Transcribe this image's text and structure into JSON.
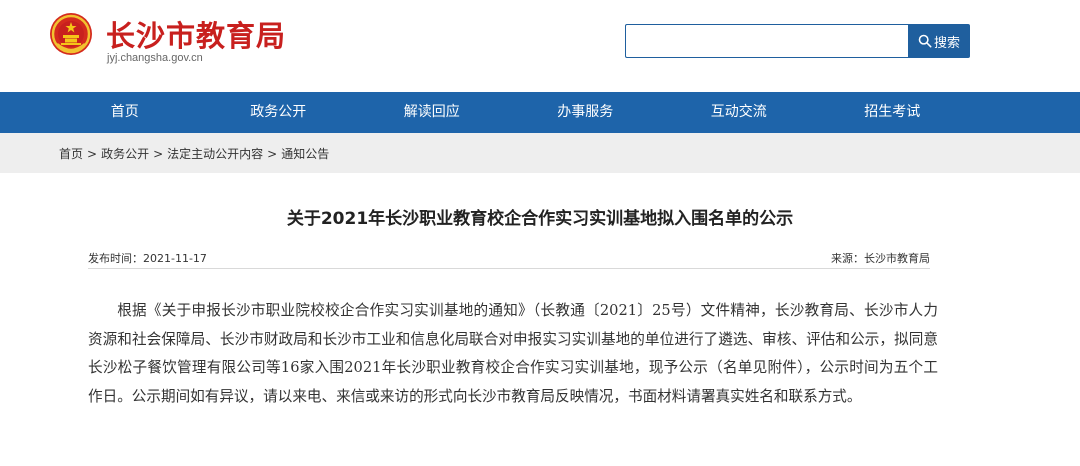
{
  "header": {
    "site_title": "长沙市教育局",
    "site_domain": "jyj.changsha.gov.cn",
    "emblem_icon": "national-emblem-icon",
    "search": {
      "placeholder": "",
      "button_label": "搜索",
      "button_icon": "search-icon"
    }
  },
  "colors": {
    "brand_red": "#c8201e",
    "nav_blue": "#1e64aa",
    "search_blue": "#1f5f9e",
    "crumb_bg": "#eeeeee"
  },
  "nav": {
    "items": [
      {
        "label": "首页"
      },
      {
        "label": "政务公开"
      },
      {
        "label": "解读回应"
      },
      {
        "label": "办事服务"
      },
      {
        "label": "互动交流"
      },
      {
        "label": "招生考试"
      }
    ]
  },
  "breadcrumb": {
    "items": [
      "首页",
      "政务公开",
      "法定主动公开内容",
      "通知公告"
    ],
    "separator": ">"
  },
  "article": {
    "title": "关于2021年长沙职业教育校企合作实习实训基地拟入围名单的公示",
    "publish_time": "发布时间：2021-11-17",
    "source": "来源：长沙市教育局",
    "paragraph": "根据《关于申报长沙市职业院校校企合作实习实训基地的通知》（长教通〔2021〕25号）文件精神，长沙教育局、长沙市人力资源和社会保障局、长沙市财政局和长沙市工业和信息化局联合对申报实习实训基地的单位进行了遴选、审核、评估和公示，拟同意长沙松子餐饮管理有限公司等16家入围2021年长沙职业教育校企合作实习实训基地，现予公示（名单见附件），公示时间为五个工作日。公示期间如有异议，请以来电、来信或来访的形式向长沙市教育局反映情况，书面材料请署真实姓名和联系方式。"
  }
}
